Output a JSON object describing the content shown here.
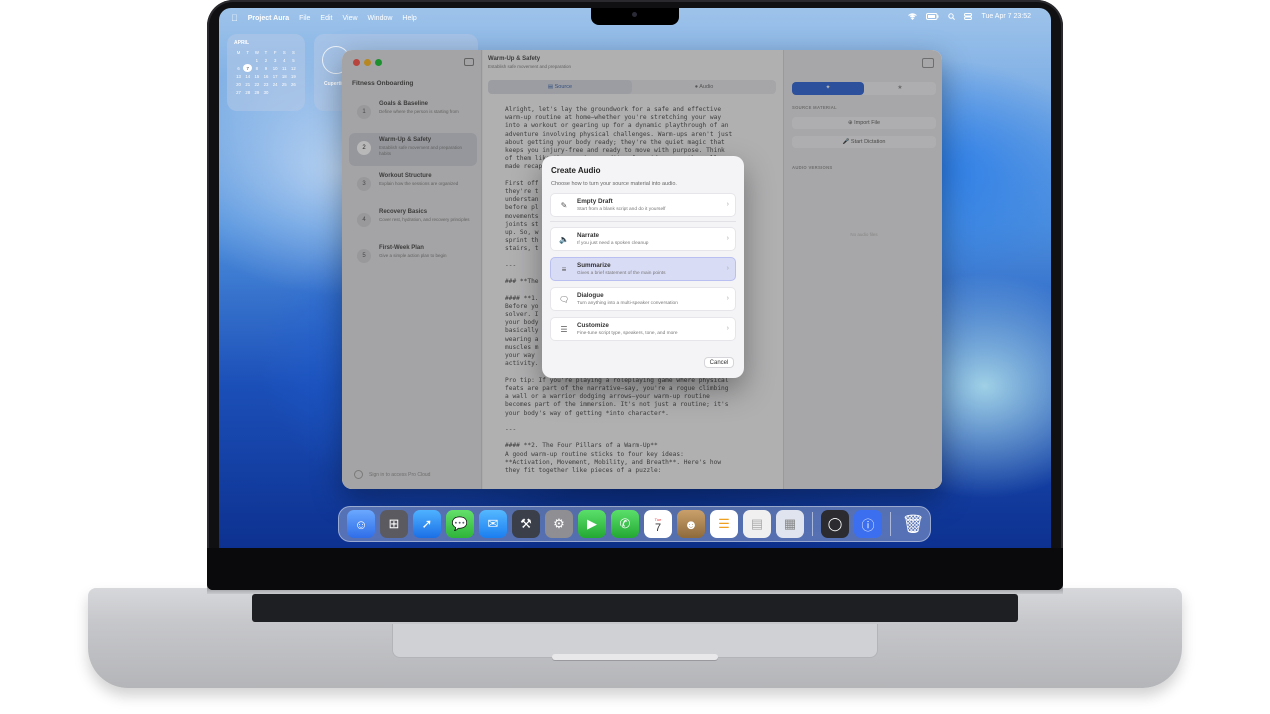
{
  "menubar": {
    "apple_icon": "apple-icon",
    "app_name": "Project Aura",
    "menus": [
      "File",
      "Edit",
      "View",
      "Window",
      "Help"
    ],
    "datetime": "Tue Apr 7  23:52"
  },
  "calendar_widget": {
    "month": "APRIL",
    "weekdays": [
      "M",
      "T",
      "W",
      "T",
      "F",
      "S",
      "S"
    ],
    "rows": [
      [
        "",
        "",
        "1",
        "2",
        "3",
        "4",
        "5"
      ],
      [
        "6",
        "7",
        "8",
        "9",
        "10",
        "11",
        "12"
      ],
      [
        "13",
        "14",
        "15",
        "16",
        "17",
        "18",
        "19"
      ],
      [
        "20",
        "21",
        "22",
        "23",
        "24",
        "25",
        "26"
      ],
      [
        "27",
        "28",
        "29",
        "30",
        "",
        "",
        ""
      ]
    ],
    "today": "7"
  },
  "clock_widget": {
    "city": "Cupertino"
  },
  "sidebar": {
    "title": "Fitness Onboarding",
    "steps": [
      {
        "num": "1",
        "title": "Goals & Baseline",
        "desc": "Define where the person is starting from"
      },
      {
        "num": "2",
        "title": "Warm-Up & Safety",
        "desc": "Establish safe movement and preparation habits"
      },
      {
        "num": "3",
        "title": "Workout Structure",
        "desc": "Explain how the sessions are organized"
      },
      {
        "num": "4",
        "title": "Recovery Basics",
        "desc": "Cover rest, hydration, and recovery principles"
      },
      {
        "num": "5",
        "title": "First-Week Plan",
        "desc": "Give a simple action plan to begin"
      }
    ],
    "signin": "Sign in to access Pro Cloud"
  },
  "editor": {
    "title": "Warm-Up & Safety",
    "subtitle": "Establish safe movement and preparation",
    "tabs": [
      "Source",
      "Audio"
    ],
    "text": "Alright, let's lay the groundwork for a safe and effective\nwarm-up routine at home—whether you're stretching your way\ninto a workout or gearing up for a dynamic playthrough of an\nadventure involving physical challenges. Warm-ups aren't just\nabout getting your body ready; they're the quiet magic that\nkeeps you injury-free and ready to move with purpose. Think\nof them like the opening credits of a video game—the well-\nmade recap before the action.\n\nFirst off\nthey're t\nunderstan\nbefore pl\nmovements\njoints st\nup. So, w\nsprint th\nstairs, t\n\n---\n\n### **The\n\n#### **1.\nBefore yo\nsolver. I\nyour body\nbasically\nwearing a\nmuscles m\nyour way \nactivity.\n\nPro tip: If you're playing a roleplaying game where physical\nfeats are part of the narrative—say, you're a rogue climbing\na wall or a warrior dodging arrows—your warm-up routine\nbecomes part of the immersion. It's not just a routine; it's\nyour body's way of getting *into character*.\n\n---\n\n#### **2. The Four Pillars of a Warm-Up**\nA good warm-up routine sticks to four key ideas:\n**Activation, Movement, Mobility, and Breath**. Here's how\nthey fit together like pieces of a puzzle:"
  },
  "inspector": {
    "section_source": "SOURCE MATERIAL",
    "import_label": "Import File",
    "dictation_label": "Start Dictation",
    "section_audio": "AUDIO VERSIONS",
    "empty": "No audio files"
  },
  "dialog": {
    "title": "Create Audio",
    "subtitle": "Choose how to turn your source material into audio.",
    "options": [
      {
        "name": "Empty Draft",
        "desc": "Start from a blank script and do it yourself",
        "icon": "draft-icon"
      },
      {
        "name": "Narrate",
        "desc": "If you just need a spoken cleanup",
        "icon": "speaker-icon"
      },
      {
        "name": "Summarize",
        "desc": "Gives a brief statement of the main points",
        "icon": "list-icon"
      },
      {
        "name": "Dialogue",
        "desc": "Turn anything into a multi-speaker conversation",
        "icon": "chat-bubbles-icon"
      },
      {
        "name": "Customize",
        "desc": "Fine-tune script type, speakers, tone, and more",
        "icon": "sliders-icon"
      }
    ],
    "selected": "Summarize",
    "cancel_label": "Cancel"
  },
  "dock": {
    "date_icon_day": "Tue",
    "date_icon_num": "7"
  },
  "colors": {
    "accent": "#3e6fd8",
    "selected_option": "#d9dcf5"
  }
}
